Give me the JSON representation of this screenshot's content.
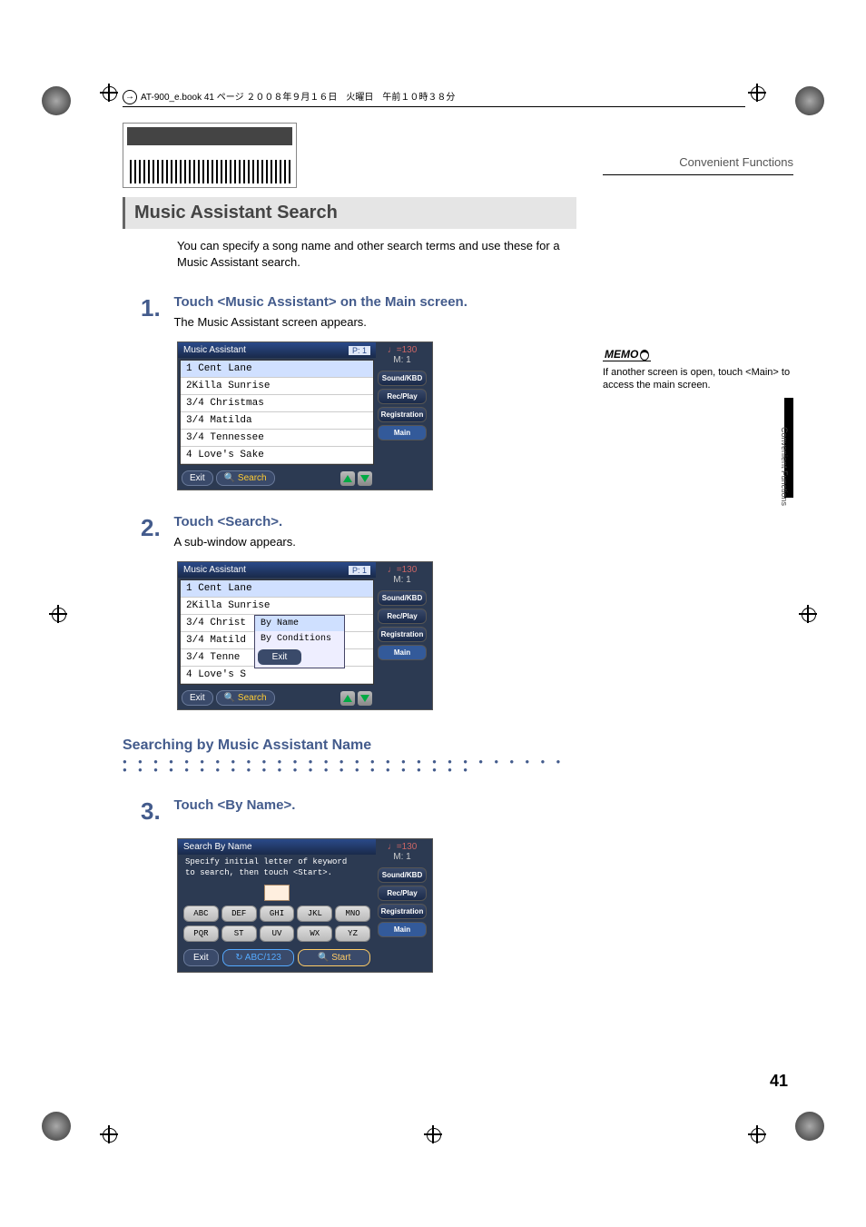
{
  "meta_header": "AT-900_e.book  41 ページ  ２００８年９月１６日　火曜日　午前１０時３８分",
  "chapter_title": "Convenient Functions",
  "section_title": "Music Assistant Search",
  "intro": "You can specify a song name and other search terms and use these for a Music Assistant search.",
  "step1": {
    "num": "1.",
    "title": "Touch <Music Assistant> on the Main screen.",
    "desc": "The Music Assistant screen appears."
  },
  "ss1": {
    "title": "Music Assistant",
    "page": "P: 1",
    "tempo": "♩=130",
    "measure": "M:    1",
    "items": [
      "1 Cent Lane",
      "2Killa Sunrise",
      "3/4 Christmas",
      "3/4 Matilda",
      "3/4 Tennessee",
      "4 Love's Sake"
    ],
    "exit": "Exit",
    "search": "🔍 Search",
    "side": [
      "Sound/KBD",
      "Rec/Play",
      "Registration",
      "Main"
    ]
  },
  "step2": {
    "num": "2.",
    "title": "Touch <Search>.",
    "desc": "A sub-window appears."
  },
  "ss2": {
    "title": "Music Assistant",
    "page": "P: 1",
    "tempo": "♩=130",
    "measure": "M:    1",
    "items": [
      "1 Cent Lane",
      "2Killa Sunrise",
      "3/4 Christ",
      "3/4 Matild",
      "3/4 Tenne",
      "4 Love's S"
    ],
    "popup": [
      "By Name",
      "By Conditions"
    ],
    "popup_exit": "Exit",
    "exit": "Exit",
    "search": "🔍 Search",
    "side": [
      "Sound/KBD",
      "Rec/Play",
      "Registration",
      "Main"
    ]
  },
  "subheading": "Searching by Music Assistant Name",
  "step3": {
    "num": "3.",
    "title": "Touch <By Name>."
  },
  "ss3": {
    "title": "Search By Name",
    "instr1": "Specify initial letter of keyword",
    "instr2": "to search, then touch <Start>.",
    "row1": [
      "ABC",
      "DEF",
      "GHI",
      "JKL",
      "MNO"
    ],
    "row2": [
      "PQR",
      "ST",
      "UV",
      "WX",
      "YZ"
    ],
    "exit": "Exit",
    "toggle": "↻ ABC/123",
    "start": "🔍 Start",
    "tempo": "♩=130",
    "measure": "M:    1",
    "side": [
      "Sound/KBD",
      "Rec/Play",
      "Registration",
      "Main"
    ]
  },
  "memo": {
    "label": "MEMO",
    "text": "If another screen is open, touch <Main> to access the main screen."
  },
  "vert": "Convenient Functions",
  "pagenum": "41"
}
